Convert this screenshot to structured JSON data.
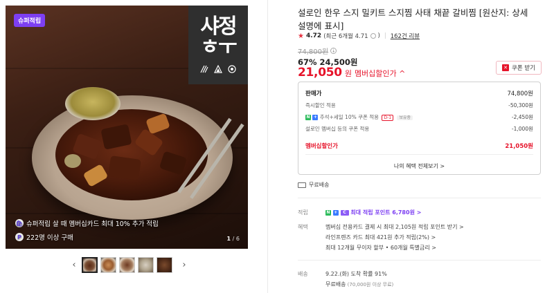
{
  "image": {
    "badge": "슈퍼적립",
    "brand_logo": "샤정 ㅎㅜ",
    "info_lines": [
      {
        "icon": "🛍",
        "text": "슈퍼적립 살 때 멤버십카드 최대 10% 추가 적립"
      },
      {
        "icon": "P",
        "text": "222명 이상 구매"
      }
    ],
    "counter_current": "1",
    "counter_total": " / 6"
  },
  "thumbnails": {
    "prev_label": "‹",
    "next_label": "›"
  },
  "product": {
    "title": "설로인 한우 스지 밀키트 스지찜 사태 채끝 갈비찜 [원산지: 상세설명에 표시]",
    "rating_star": "★",
    "rating": "4.72",
    "rating_recent": "(최근 6개월 4.71",
    "rating_recent_close": ")",
    "reviews": "162건 리뷰",
    "original_price": "74,800원",
    "discount_line": "67% 24,500원",
    "member_price": "21,050",
    "member_price_unit": "원",
    "member_price_label": "멤버십할인가 ^",
    "coupon_button": "쿠폰 받기"
  },
  "price_box": {
    "rows": [
      {
        "label": "판매가",
        "value": "74,800원"
      },
      {
        "label": "즉시할인 적용",
        "value": "-50,300원"
      },
      {
        "label": "추석+세일 10% 쿠폰 적용",
        "tag": "D-1",
        "tag2": "보유중",
        "value": "-2,450원"
      },
      {
        "label": "설로인 멤버십 등의 쿠폰 적용",
        "value": "-1,000원"
      }
    ],
    "total_label": "멤버십할인가",
    "total_value": "21,050원",
    "benefit_all": "나의 혜택 전체보기 >"
  },
  "free_shipping": "무료배송",
  "points": {
    "label": "적립",
    "value": "최대 적립 포인트 6,780원 >"
  },
  "benefits": {
    "label": "혜택",
    "lines": [
      "멤버십 전용카드 결제 시 최대 2,105원 적립 포인트 받기 >",
      "라인프렌즈 카드 최대 421원 추가 적립(2%) >",
      "최대 12개월 무이자 할부 • 60개월 특별금리 >"
    ]
  },
  "delivery": {
    "label": "배송",
    "line1": "9.22.(화) 도착 확률 91%",
    "line2": "무료배송",
    "line2_note": " (70,000원 이상 무료)"
  }
}
